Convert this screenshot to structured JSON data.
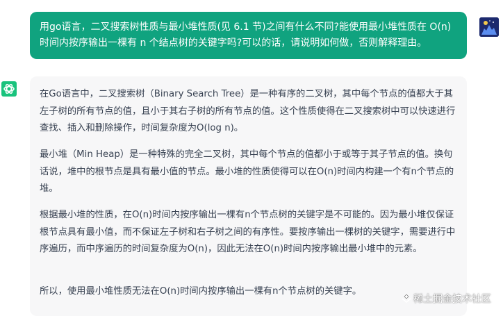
{
  "user_message": {
    "line1": "用go语言，二叉搜索树性质与最小堆性质(见 6.1 节)之间有什么不同?能使用最小堆性质在 O(n)",
    "line2": "时间内按序输出一棵有 n 个结点树的关键字吗?可以的话，请说明如何做，否则解释理由。"
  },
  "assistant_reply": {
    "paragraphs": [
      "在Go语言中，二叉搜索树（Binary Search Tree）是一种有序的二叉树，其中每个节点的值都大于其左子树的所有节点的值，且小于其右子树的所有节点的值。这个性质使得在二叉搜索树中可以快速进行查找、插入和删除操作，时间复杂度为O(log n)。",
      "最小堆（Min Heap）是一种特殊的完全二叉树，其中每个节点的值都小于或等于其子节点的值。换句话说，堆中的根节点是具有最小值的节点。最小堆的性质使得可以在O(n)时间内构建一个有n个节点的堆。",
      "根据最小堆的性质，在O(n)时间内按序输出一棵有n个节点树的关键字是不可能的。因为最小堆仅保证根节点具有最小值，而不保证左子树和右子树之间的有序性。要按序输出一棵树的关键字，需要进行中序遍历，而中序遍历的时间复杂度为O(n)，因此无法在O(n)时间内按序输出最小堆中的元素。",
      "所以，使用最小堆性质无法在O(n)时间内按序输出一棵有n个节点树的关键字。"
    ]
  },
  "watermark": "稀土掘金技术社区",
  "icons": {
    "assistant_avatar": "openai-logo-icon",
    "user_avatar": "user-avatar-image",
    "watermark_icon": "juejin-logo-icon"
  },
  "colors": {
    "user_bubble": "#10a37f",
    "assistant_bg": "#f7f7f8",
    "assistant_avatar": "#19c37d",
    "reply_text": "#374151"
  }
}
